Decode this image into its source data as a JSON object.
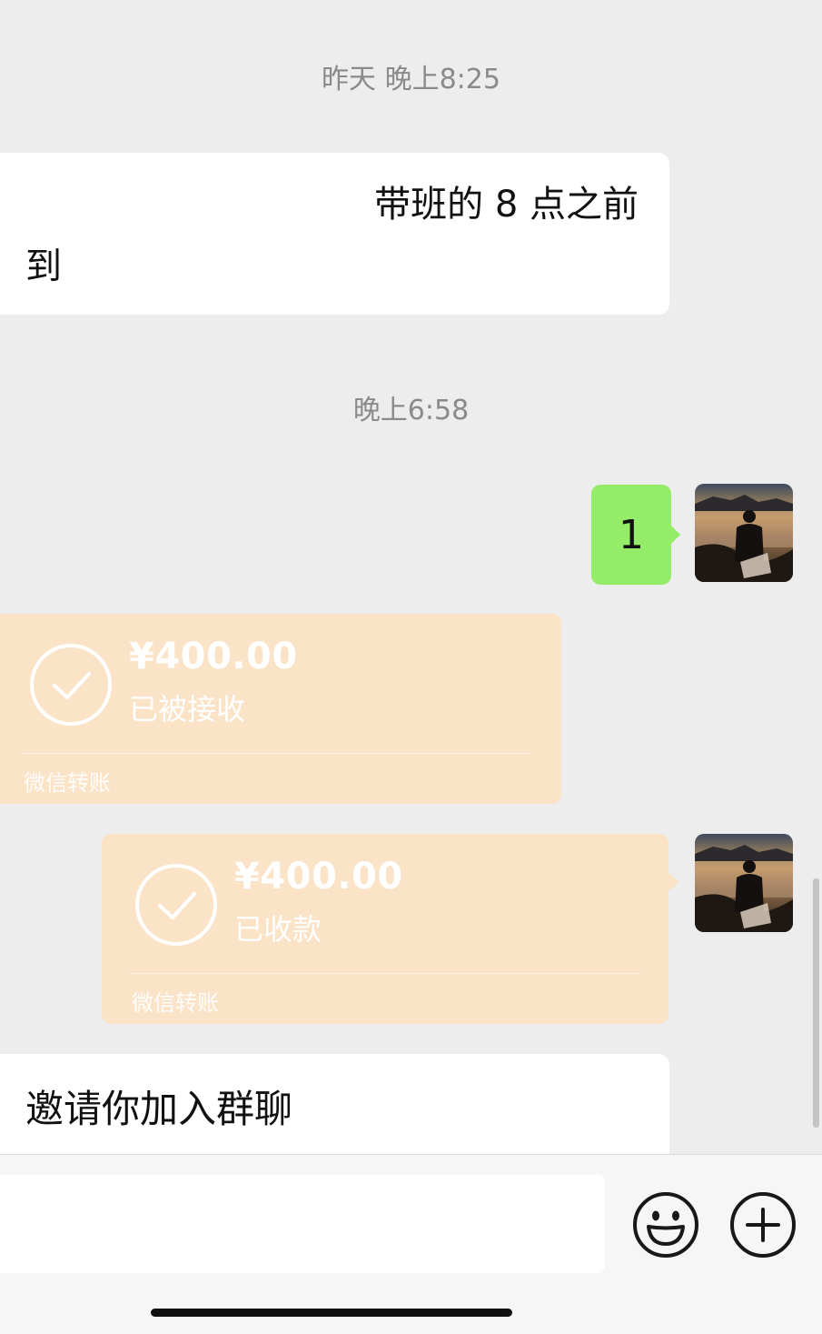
{
  "timestamps": {
    "first": "昨天 晚上8:25",
    "second": "晚上6:58"
  },
  "messages": {
    "incoming_text_line1": "带班的 8 点之前",
    "incoming_text_line2": "到",
    "outgoing_text": "1"
  },
  "transfer_received": {
    "amount": "¥400.00",
    "status": "已被接收",
    "label": "微信转账"
  },
  "transfer_collected": {
    "amount": "¥400.00",
    "status": "已收款",
    "label": "微信转账"
  },
  "invite": {
    "title": "邀请你加入群聊"
  },
  "input_bar": {
    "emoji_icon": "smiley-face-icon",
    "plus_icon": "plus-circle-icon"
  },
  "colors": {
    "background": "#ededed",
    "sent_bubble": "#95ec69",
    "transfer_card": "#fbe3c7"
  }
}
